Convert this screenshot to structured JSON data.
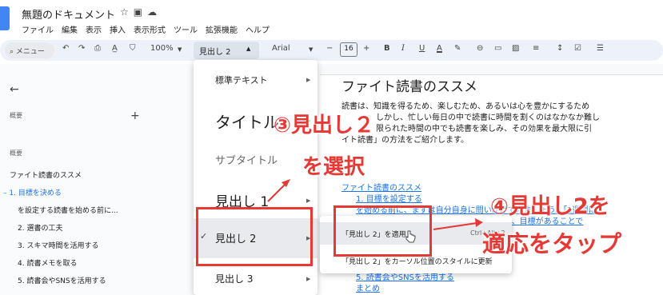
{
  "app": {
    "doc_title": "無題のドキュメント",
    "menus": [
      "ファイル",
      "編集",
      "表示",
      "挿入",
      "表示形式",
      "ツール",
      "拡張機能",
      "ヘルプ"
    ]
  },
  "toolbar": {
    "search_label": "メニュー",
    "zoom": "100%",
    "style_value": "見出し 2",
    "font": "Arial",
    "font_size": "16",
    "bold": "B",
    "italic": "I",
    "underline": "U",
    "text_color": "A"
  },
  "sidebar": {
    "summary_label": "概要",
    "outline_label": "概要",
    "outline_items": [
      "ファイト読書のススメ",
      "1. 目標を決める",
      "を設定する読書を始める前に...",
      "2. 選書の工夫",
      "3. スキマ時間を活用する",
      "4. 読書メモを取る",
      "5. 読書会やSNSを活用する"
    ]
  },
  "style_menu": {
    "items": [
      {
        "label": "標準テキスト"
      },
      {
        "label": "タイトル"
      },
      {
        "label": "サブタイトル"
      },
      {
        "label": "見出し 1"
      },
      {
        "label": "見出し 2"
      },
      {
        "label": "見出し 3"
      }
    ]
  },
  "heading_submenu": {
    "apply_label": "「見出し 2」を適用",
    "apply_shortcut": "Ctrl+Alt+2",
    "update_label": "「見出し 2」をカーソル位置のスタイルに更新"
  },
  "document": {
    "heading": "ファイト読書のススメ",
    "para_lines": [
      "読書は、知識を得るため、楽しむため、あるいは心を豊かにするため",
      "しかし、忙しい毎日の中で読書に時間を割くのはなかなか難し",
      "限られた時間の中でも読書を楽しみ、その効果を最大限に引",
      "イト読書」の方法をご紹介します。"
    ],
    "toc": [
      "ファイト読書のススメ",
      "1. 目標を設定する",
      "を始める前に、まずは自分自身に問いかけてみましょう。「1週間に",
      "ページ以上」「現実的な目標を立てることが、目標があることで",
      "5. 読書会やSNSを活用する",
      "まとめ"
    ]
  },
  "annotations": {
    "step3_line1": "③見出し２",
    "step3_line2": "を選択",
    "step4_line1": "④見出し2を",
    "step4_line2": "適応をタップ",
    "color": "#e53935"
  },
  "colors": {
    "accent": "#1a73e8",
    "toolbar_bg": "#edf2fa",
    "highlight": "#e53935"
  }
}
